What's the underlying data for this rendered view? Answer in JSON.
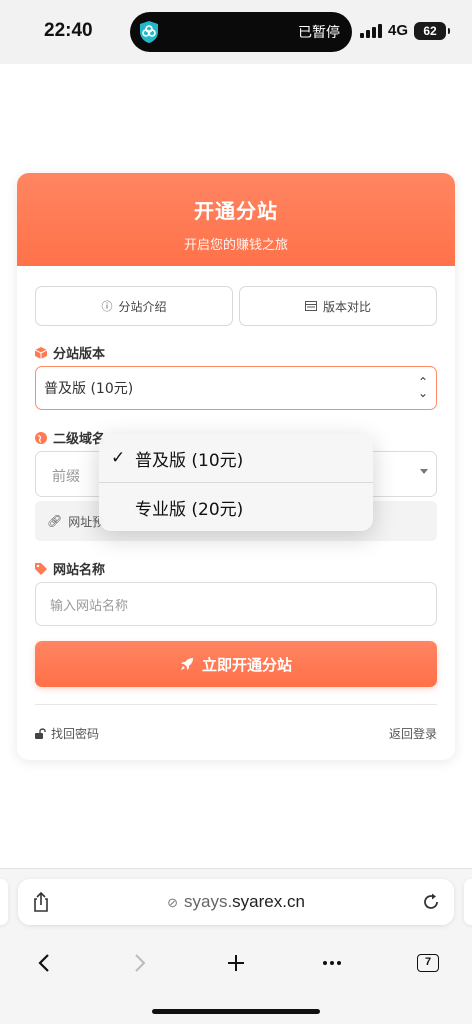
{
  "status_bar": {
    "time": "22:40",
    "paused_label": "已暂停",
    "network": "4G",
    "battery": "62"
  },
  "header": {
    "title": "开通分站",
    "subtitle": "开启您的赚钱之旅"
  },
  "tabs": {
    "intro": "分站介绍",
    "compare": "版本对比"
  },
  "version": {
    "label": "分站版本",
    "selected": "普及版 (10元)"
  },
  "domain": {
    "label": "二级域名",
    "prefix_placeholder": "前缀",
    "preview": "网址预"
  },
  "site_name": {
    "label": "网站名称",
    "placeholder": "输入网站名称"
  },
  "submit": {
    "label": "立即开通分站"
  },
  "footer": {
    "forgot": "找回密码",
    "back": "返回登录"
  },
  "dropdown": {
    "options": [
      {
        "label": "普及版 (10元)",
        "checked": true
      },
      {
        "label": "专业版 (20元)",
        "checked": false
      }
    ]
  },
  "browser": {
    "url_prefix": "syays.",
    "url_domain": "syarex.cn",
    "tab_count": "7"
  },
  "colors": {
    "accent": "#ff7249",
    "accent_light": "#ff8a65"
  }
}
